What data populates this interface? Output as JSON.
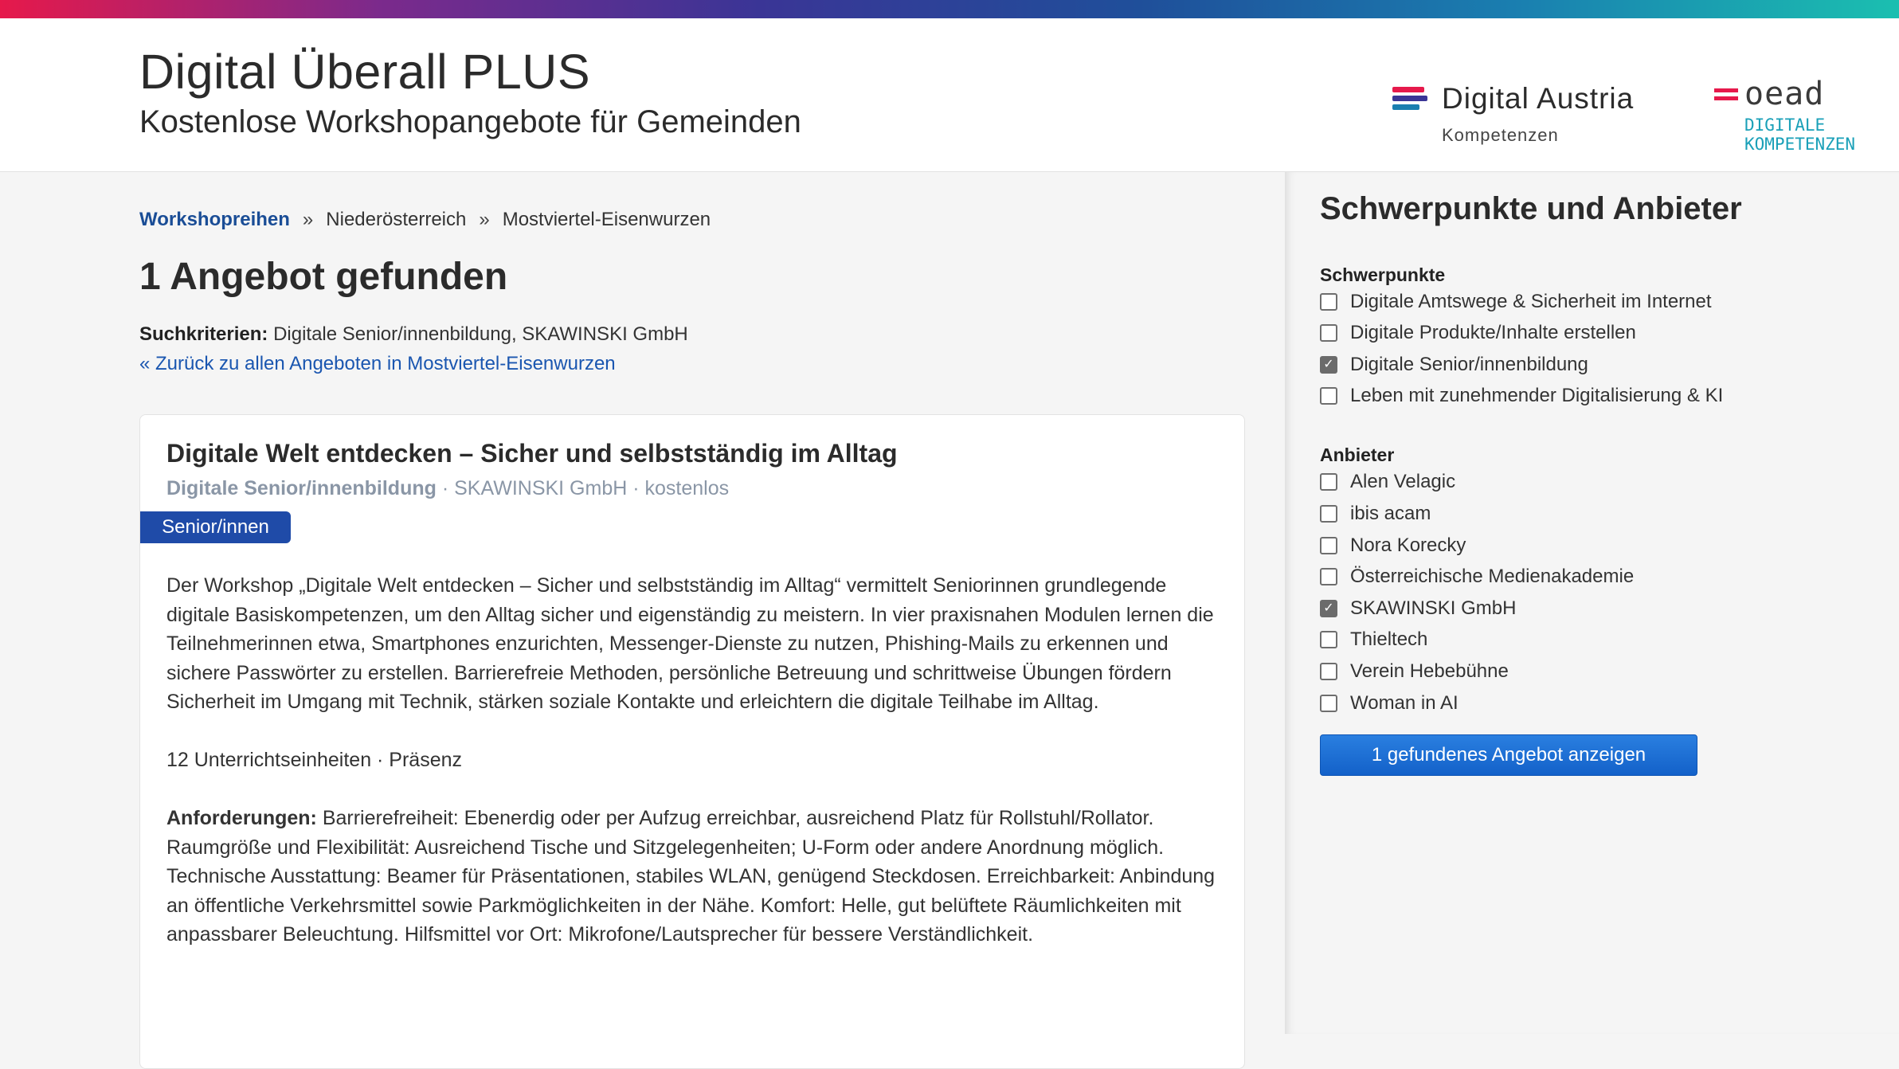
{
  "header": {
    "title": "Digital Überall PLUS",
    "subtitle": "Kostenlose Workshopangebote für Gemeinden",
    "logo_da": {
      "name": "Digital Austria",
      "sub": "Kompetenzen"
    },
    "logo_oead": {
      "name": "oead",
      "sub_line1": "DIGITALE",
      "sub_line2": "KOMPETENZEN"
    }
  },
  "breadcrumb": {
    "items": [
      "Workshopreihen",
      "Niederösterreich",
      "Mostviertel-Eisenwurzen"
    ],
    "separator": "»"
  },
  "results": {
    "count_title": "1 Angebot gefunden",
    "criteria_label": "Suchkriterien:",
    "criteria_value": "Digitale Senior/innenbildung, SKAWINSKI GmbH",
    "back_link": "« Zurück zu allen Angeboten in Mostviertel-Eisenwurzen"
  },
  "card": {
    "title": "Digitale Welt entdecken – Sicher und selbstständig im Alltag",
    "meta_focus": "Digitale Senior/innenbildung",
    "meta_rest": " · SKAWINSKI GmbH · kostenlos",
    "tag": "Senior/innen",
    "description": "Der Workshop „Digitale Welt entdecken – Sicher und selbstständig im Alltag“ vermittelt Seniorinnen grundlegende digitale Basiskompetenzen, um den Alltag sicher und eigenständig zu meistern. In vier praxisnahen Modulen lernen die Teilnehmerinnen etwa, Smartphones enzurichten, Messenger-Dienste zu nutzen, Phishing-Mails zu erkennen und sichere Passwörter zu erstellen. Barrierefreie Methoden, persönliche Betreuung und schrittweise Übungen fördern Sicherheit im Umgang mit Technik, stärken soziale Kontakte und erleichtern die digitale Teilhabe im Alltag.",
    "units": "12 Unterrichtseinheiten · Präsenz",
    "requirements_label": "Anforderungen:",
    "requirements": " Barrierefreiheit: Ebenerdig oder per Aufzug erreichbar, ausreichend Platz für Rollstuhl/Rollator. Raumgröße und Flexibilität: Ausreichend Tische und Sitzgelegenheiten; U-Form oder andere Anordnung möglich. Technische Ausstattung: Beamer für Präsentationen, stabiles WLAN, genügend Steckdosen. Erreichbarkeit: Anbindung an öffentliche Verkehrsmittel sowie Parkmöglichkeiten in der Nähe. Komfort: Helle, gut belüftete Räumlichkeiten mit anpassbarer Beleuchtung. Hilfsmittel vor Ort: Mikrofone/Lautsprecher für bessere Verständlichkeit."
  },
  "sidebar": {
    "title": "Schwerpunkte und Anbieter",
    "focus_label": "Schwerpunkte",
    "focus": [
      {
        "label": "Digitale Amtswege & Sicherheit im Internet",
        "checked": false
      },
      {
        "label": "Digitale Produkte/Inhalte erstellen",
        "checked": false
      },
      {
        "label": "Digitale Senior/innenbildung",
        "checked": true
      },
      {
        "label": "Leben mit zunehmender Digitalisierung & KI",
        "checked": false
      }
    ],
    "providers_label": "Anbieter",
    "providers": [
      {
        "label": "Alen Velagic",
        "checked": false
      },
      {
        "label": "ibis acam",
        "checked": false
      },
      {
        "label": "Nora Korecky",
        "checked": false
      },
      {
        "label": "Österreichische Medienakademie",
        "checked": false
      },
      {
        "label": "SKAWINSKI GmbH",
        "checked": true
      },
      {
        "label": "Thieltech",
        "checked": false
      },
      {
        "label": "Verein Hebebühne",
        "checked": false
      },
      {
        "label": "Woman in AI",
        "checked": false
      }
    ],
    "button": "1 gefundenes Angebot anzeigen"
  },
  "colors": {
    "link": "#1a4d96",
    "tag_bg": "#1f4ba8",
    "button": "#1a6fd8",
    "meta": "#8a96a6"
  }
}
